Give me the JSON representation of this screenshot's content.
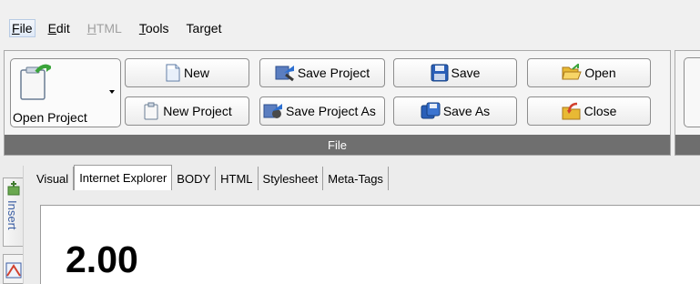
{
  "menu": {
    "items": [
      {
        "label": "File",
        "mnemonic": "F",
        "rest": "ile",
        "state": "active"
      },
      {
        "label": "Edit",
        "mnemonic": "E",
        "rest": "dit",
        "state": "normal"
      },
      {
        "label": "HTML",
        "mnemonic": "H",
        "rest": "TML",
        "state": "disabled"
      },
      {
        "label": "Tools",
        "mnemonic": "T",
        "rest": "ools",
        "state": "normal"
      },
      {
        "label": "Target",
        "pre": "Tar",
        "mnemonic": "g",
        "rest": "et",
        "state": "normal"
      }
    ]
  },
  "ribbon": {
    "group_label": "File",
    "open_project_label": "Open Project",
    "buttons": {
      "new": "New",
      "save_project": "Save Project",
      "save": "Save",
      "open": "Open",
      "new_project": "New Project",
      "save_project_as": "Save Project As",
      "save_as": "Save As",
      "close": "Close"
    }
  },
  "sidebar": {
    "insert_label": "Insert"
  },
  "tabs": [
    {
      "label": "Visual",
      "active": false
    },
    {
      "label": "Internet Explorer",
      "active": true
    },
    {
      "label": "BODY",
      "active": false
    },
    {
      "label": "HTML",
      "active": false
    },
    {
      "label": "Stylesheet",
      "active": false
    },
    {
      "label": "Meta-Tags",
      "active": false
    }
  ],
  "document": {
    "value": "2.00"
  },
  "colors": {
    "group_bar": "#6f6f6f",
    "menu_active_bg": "#dfe9f7",
    "sidebar_text": "#3b5ea3"
  }
}
